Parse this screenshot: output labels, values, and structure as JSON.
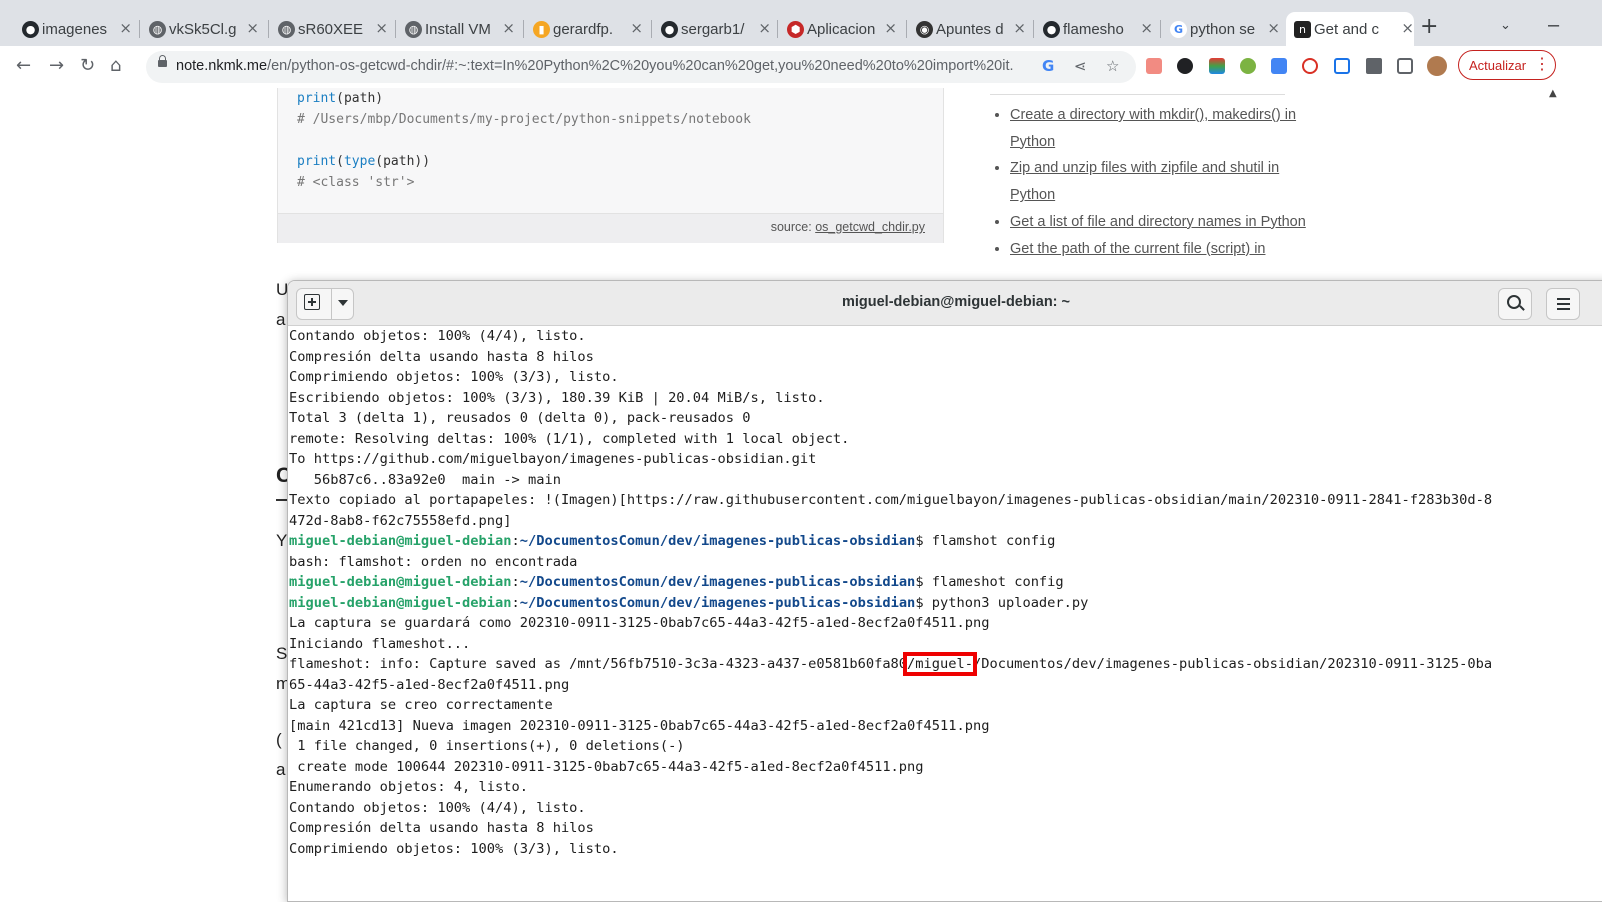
{
  "browser": {
    "tabs": [
      {
        "title": "imagenes",
        "icon": "github-icon",
        "active": false
      },
      {
        "title": "vkSk5Cl.g",
        "icon": "globe-icon",
        "active": false
      },
      {
        "title": "sR60XEE",
        "icon": "globe-icon",
        "active": false
      },
      {
        "title": "Install VM",
        "icon": "globe-icon",
        "active": false
      },
      {
        "title": "gerardfp.",
        "icon": "colorful-icon",
        "active": false
      },
      {
        "title": "sergarb1/",
        "icon": "github-icon",
        "active": false
      },
      {
        "title": "Aplicacion",
        "icon": "red-shield-icon",
        "active": false
      },
      {
        "title": "Apuntes d",
        "icon": "eye-icon",
        "active": false
      },
      {
        "title": "flamesho",
        "icon": "github-icon",
        "active": false
      },
      {
        "title": "python se",
        "icon": "google-icon",
        "active": false
      },
      {
        "title": "Get and c",
        "icon": "nkmk-icon",
        "active": true
      }
    ],
    "url_host": "note.nkmk.me",
    "url_rest": "/en/python-os-getcwd-chdir/#:~:text=In%20Python%2C%20you%20can%20get,you%20need%20to%20import%20it.",
    "update_label": "Actualizar"
  },
  "page": {
    "code_lines": [
      {
        "kw": "print",
        "rest": "(path)",
        "type": "code"
      },
      {
        "text": "# /Users/mbp/Documents/my-project/python-snippets/notebook",
        "type": "comment"
      },
      {
        "text": "",
        "type": "blank"
      },
      {
        "kw": "print",
        "rest": "(",
        "kw2": "type",
        "rest2": "(path))",
        "type": "code2"
      },
      {
        "text": "# <class 'str'>",
        "type": "comment"
      }
    ],
    "source_label": "source:",
    "source_link": "os_getcwd_chdir.py",
    "sidebar_links": [
      "Create a directory with mkdir(), makedirs() in Python",
      "Zip and unzip files with zipfile and shutil in Python",
      "Get a list of file and directory names in Python",
      "Get the path of the current file (script) in"
    ],
    "fragments": [
      "U",
      "a",
      "C",
      "Y",
      "S",
      "m",
      "(",
      "a"
    ]
  },
  "terminal": {
    "title": "miguel-debian@miguel-debian: ~",
    "prompt_user": "miguel-debian@miguel-debian",
    "prompt_path": "~/DocumentosComun/dev/imagenes-publicas-obsidian",
    "lines": [
      {
        "t": "Contando objetos: 100% (4/4), listo."
      },
      {
        "t": "Compresión delta usando hasta 8 hilos"
      },
      {
        "t": "Comprimiendo objetos: 100% (3/3), listo."
      },
      {
        "t": "Escribiendo objetos: 100% (3/3), 180.39 KiB | 20.04 MiB/s, listo."
      },
      {
        "t": "Total 3 (delta 1), reusados 0 (delta 0), pack-reusados 0"
      },
      {
        "t": "remote: Resolving deltas: 100% (1/1), completed with 1 local object."
      },
      {
        "t": "To https://github.com/miguelbayon/imagenes-publicas-obsidian.git"
      },
      {
        "t": "   56b87c6..83a92e0  main -> main"
      },
      {
        "t": "Texto copiado al portapapeles: !(Imagen)[https://raw.githubusercontent.com/miguelbayon/imagenes-publicas-obsidian/main/202310-0911-2841-f283b30d-8"
      },
      {
        "t": "472d-8ab8-f62c75558efd.png]"
      },
      {
        "cmd": " flamshot config"
      },
      {
        "t": "bash: flamshot: orden no encontrada"
      },
      {
        "cmd": " flameshot config"
      },
      {
        "cmd": " python3 uploader.py"
      },
      {
        "t": "La captura se guardará como 202310-0911-3125-0bab7c65-44a3-42f5-a1ed-8ecf2a0f4511.png"
      },
      {
        "t": "Iniciando flameshot..."
      },
      {
        "pre": "flameshot: info: Capture saved as /mnt/56fb7510-3c3a-4323-a437-e0581b60fa80",
        "hl": "/miguel-",
        "post": "/Documentos/dev/imagenes-publicas-obsidian/202310-0911-3125-0ba"
      },
      {
        "t": "65-44a3-42f5-a1ed-8ecf2a0f4511.png"
      },
      {
        "t": "La captura se creo correctamente"
      },
      {
        "t": "[main 421cd13] Nueva imagen 202310-0911-3125-0bab7c65-44a3-42f5-a1ed-8ecf2a0f4511.png"
      },
      {
        "t": " 1 file changed, 0 insertions(+), 0 deletions(-)"
      },
      {
        "t": " create mode 100644 202310-0911-3125-0bab7c65-44a3-42f5-a1ed-8ecf2a0f4511.png"
      },
      {
        "t": "Enumerando objetos: 4, listo."
      },
      {
        "t": "Contando objetos: 100% (4/4), listo."
      },
      {
        "t": "Compresión delta usando hasta 8 hilos"
      },
      {
        "t": "Comprimiendo objetos: 100% (3/3), listo."
      }
    ]
  },
  "colors": {
    "prompt_user": "#26a269",
    "prompt_path": "#12488b",
    "highlight": "#ee0000",
    "update": "#c5221f"
  }
}
